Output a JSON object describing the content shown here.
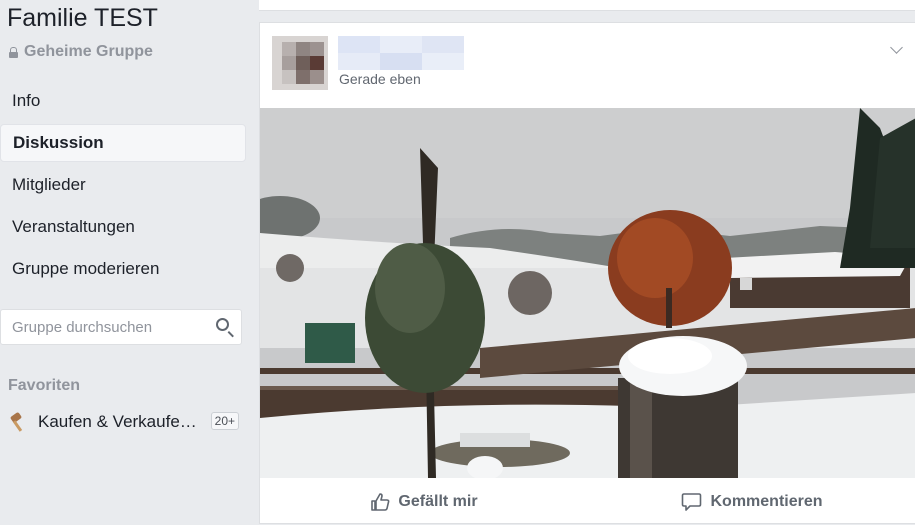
{
  "group": {
    "title": "Familie TEST",
    "privacy": "Geheime Gruppe"
  },
  "nav": {
    "items": [
      {
        "label": "Info",
        "active": false
      },
      {
        "label": "Diskussion",
        "active": true
      },
      {
        "label": "Mitglieder",
        "active": false
      },
      {
        "label": "Veranstaltungen",
        "active": false
      },
      {
        "label": "Gruppe moderieren",
        "active": false
      }
    ]
  },
  "search": {
    "placeholder": "Gruppe durchsuchen"
  },
  "favorites": {
    "heading": "Favoriten",
    "items": [
      {
        "label": "Kaufen & Verkaufe…",
        "badge": "20+",
        "icon": "gavel-icon"
      }
    ]
  },
  "post": {
    "timestamp": "Gerade eben",
    "photo_description_icon": "photo",
    "actions": {
      "like": "Gefällt mir",
      "comment": "Kommentieren"
    }
  },
  "colors": {
    "background": "#e9ebee",
    "text": "#1d2129",
    "muted": "#90949c"
  }
}
